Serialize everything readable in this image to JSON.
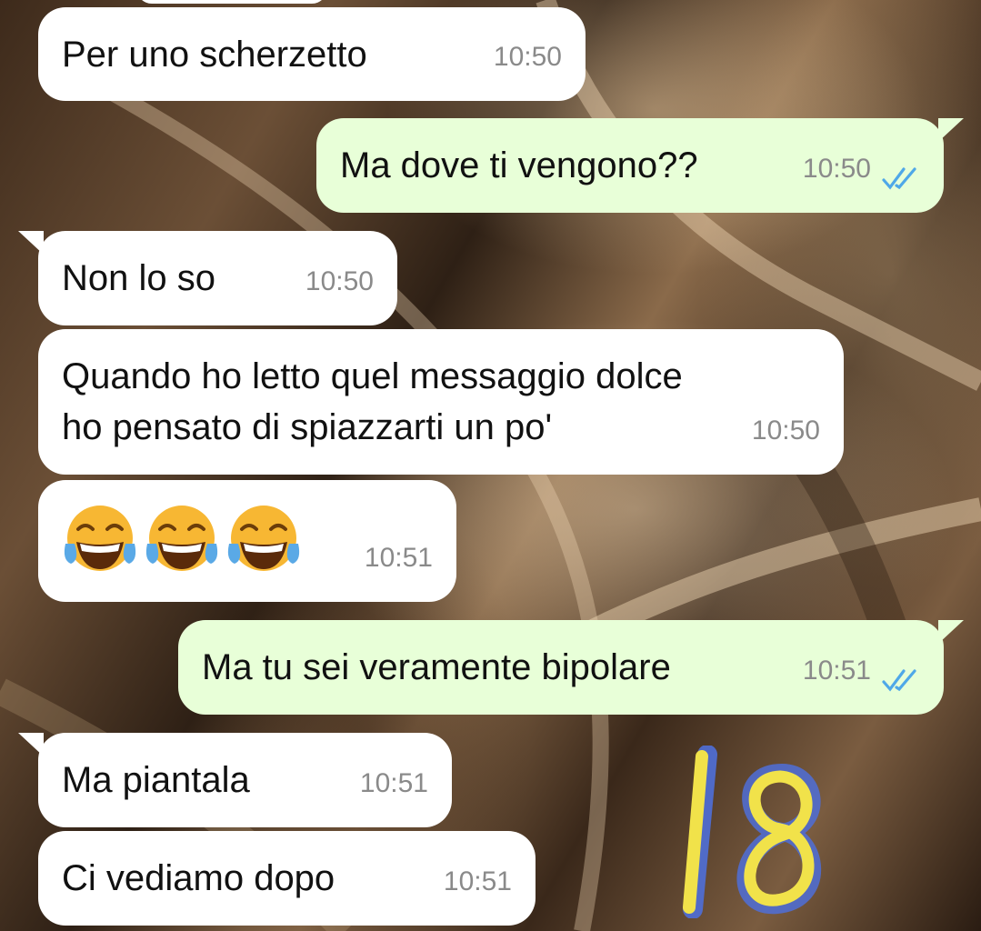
{
  "chat": {
    "messages": [
      {
        "text": "Per uno scherzetto",
        "time": "10:50"
      },
      {
        "text": "Ma dove ti vengono??",
        "time": "10:50"
      },
      {
        "text": "Non lo so",
        "time": "10:50"
      },
      {
        "text": "Quando ho letto quel messaggio dolce\nho pensato di spiazzarti un po'",
        "time": "10:50"
      },
      {
        "emoji": [
          "face-with-tears-of-joy",
          "face-with-tears-of-joy",
          "face-with-tears-of-joy"
        ],
        "time": "10:51"
      },
      {
        "text": "Ma tu sei veramente bipolare",
        "time": "10:51"
      },
      {
        "text": "Ma piantala",
        "time": "10:51"
      },
      {
        "text": "Ci vediamo dopo",
        "time": "10:51"
      }
    ]
  },
  "colors": {
    "incoming_bubble": "#ffffff",
    "outgoing_bubble": "#e8ffd8",
    "read_ticks": "#4fa8e8",
    "timestamp": "#8a8a8a"
  },
  "overlay": {
    "handwritten_number": "18"
  }
}
